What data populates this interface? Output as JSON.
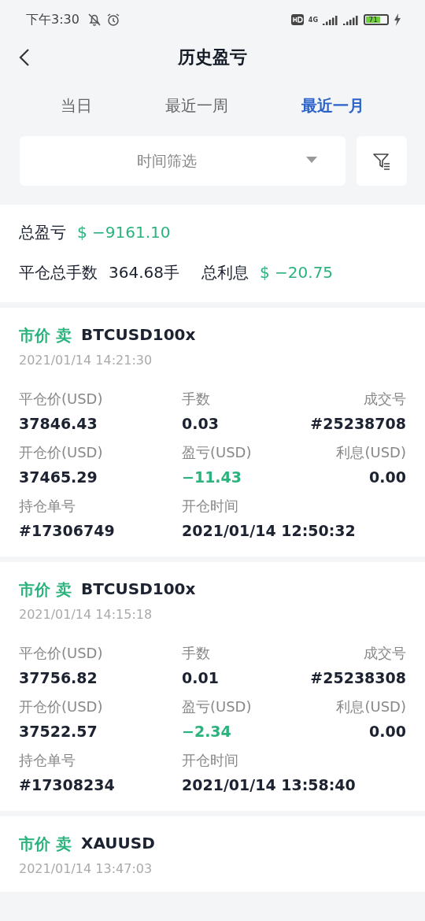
{
  "status_bar": {
    "time": "下午3:30",
    "network": "4G",
    "battery": "71"
  },
  "header": {
    "title": "历史盈亏"
  },
  "tabs": [
    {
      "label": "当日",
      "selected": false
    },
    {
      "label": "最近一周",
      "selected": false
    },
    {
      "label": "最近一月",
      "selected": true
    }
  ],
  "filter": {
    "placeholder": "时间筛选"
  },
  "summary": {
    "total_pnl_label": "总盈亏",
    "total_pnl": "$ −9161.10",
    "lots_label": "平仓总手数",
    "lots": "364.68手",
    "interest_label": "总利息",
    "interest": "$ −20.75"
  },
  "orders": [
    {
      "type": "市价 卖",
      "symbol": "BTCUSD100x",
      "time": "2021/01/14 14:21:30",
      "rows": [
        [
          {
            "label": "平仓价(USD)",
            "value": "37846.43"
          },
          {
            "label": "手数",
            "value": "0.03"
          },
          {
            "label": "成交号",
            "value": "#25238708"
          }
        ],
        [
          {
            "label": "开仓价(USD)",
            "value": "37465.29"
          },
          {
            "label": "盈亏(USD)",
            "value": "−11.43",
            "color": "#2bb37d"
          },
          {
            "label": "利息(USD)",
            "value": "0.00"
          }
        ],
        [
          {
            "label": "持仓单号",
            "value": "#17306749"
          },
          {
            "label": "开仓时间",
            "value": "2021/01/14 12:50:32"
          }
        ]
      ]
    },
    {
      "type": "市价 卖",
      "symbol": "BTCUSD100x",
      "time": "2021/01/14 14:15:18",
      "rows": [
        [
          {
            "label": "平仓价(USD)",
            "value": "37756.82"
          },
          {
            "label": "手数",
            "value": "0.01"
          },
          {
            "label": "成交号",
            "value": "#25238308"
          }
        ],
        [
          {
            "label": "开仓价(USD)",
            "value": "37522.57"
          },
          {
            "label": "盈亏(USD)",
            "value": "−2.34",
            "color": "#2bb37d"
          },
          {
            "label": "利息(USD)",
            "value": "0.00"
          }
        ],
        [
          {
            "label": "持仓单号",
            "value": "#17308234"
          },
          {
            "label": "开仓时间",
            "value": "2021/01/14 13:58:40"
          }
        ]
      ]
    },
    {
      "type": "市价 卖",
      "symbol": "XAUUSD",
      "time": "2021/01/14 13:47:03"
    }
  ]
}
